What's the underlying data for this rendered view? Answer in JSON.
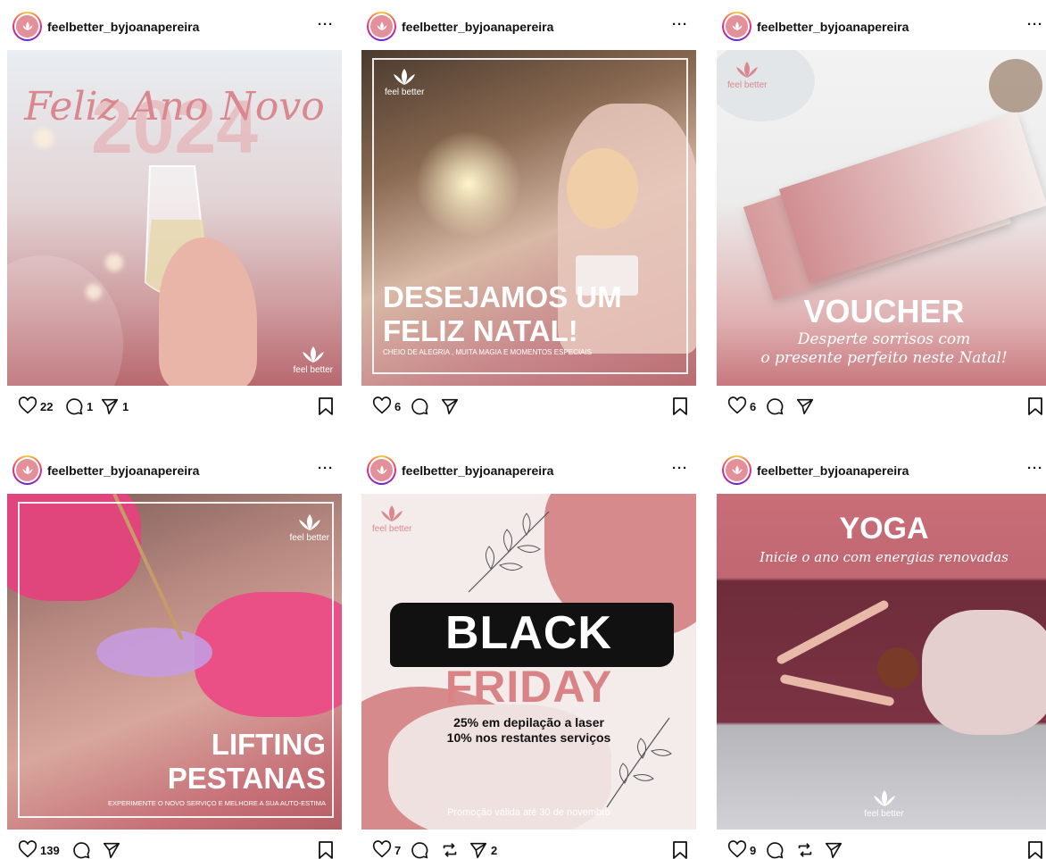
{
  "account": "feelbetter_byjoanapereira",
  "more_label": "···",
  "brand_text": "feel better",
  "posts": [
    {
      "likes": "22",
      "comments": "1",
      "shares": "1",
      "script_title": "Feliz Ano Novo",
      "big_text": "2024"
    },
    {
      "likes": "6",
      "title_line1": "DESEJAMOS UM",
      "title_line2": "FELIZ NATAL!",
      "subtitle": "CHEIO DE ALEGRIA , MUITA MAGIA E MOMENTOS ESPECIAIS"
    },
    {
      "likes": "6",
      "title": "VOUCHER",
      "script_line1": "Desperte sorrisos com",
      "script_line2": "o presente perfeito neste Natal!"
    },
    {
      "likes": "139",
      "title_line1": "LIFTING",
      "title_line2": "PESTANAS",
      "subtitle": "EXPERIMENTE O NOVO SERVIÇO E MELHORE A SUA AUTO-ESTIMA"
    },
    {
      "likes": "7",
      "shares": "2",
      "title_line1": "BLACK",
      "title_line2": "FRIDAY",
      "offer_line1": "25% em depilação a laser",
      "offer_line2": "10% nos restantes serviços",
      "footer": "Promoção válida até 30 de novembro"
    },
    {
      "likes": "9",
      "title": "YOGA",
      "script_line": "Inicie o ano com energias renovadas"
    }
  ]
}
